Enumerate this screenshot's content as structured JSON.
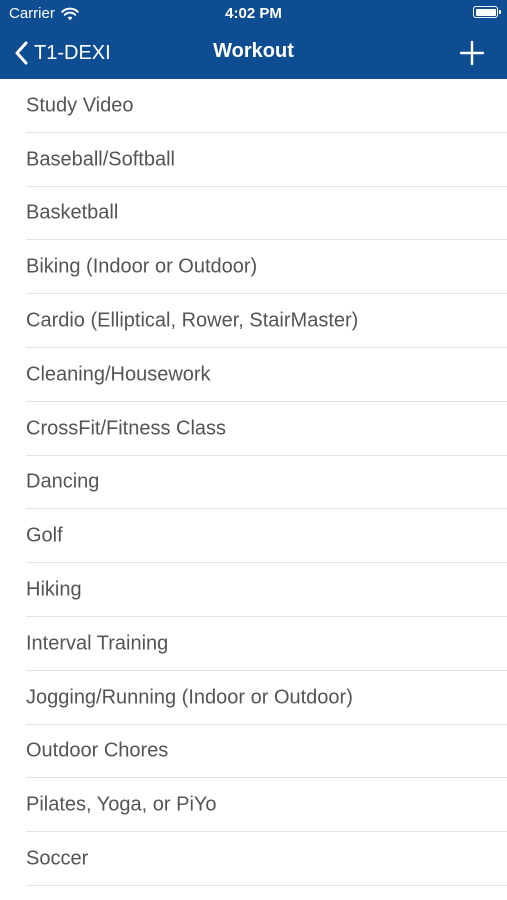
{
  "status_bar": {
    "carrier": "Carrier",
    "time": "4:02 PM"
  },
  "nav": {
    "back_label": "T1-DEXI",
    "title": "Workout"
  },
  "colors": {
    "header_bg": "#0f4d93",
    "row_text": "#545454",
    "divider": "#e3e3e3"
  },
  "icons": [
    "wifi-icon",
    "battery-icon",
    "chevron-left-icon",
    "plus-icon"
  ],
  "workouts": [
    "Study Video",
    "Baseball/Softball",
    "Basketball",
    "Biking (Indoor or Outdoor)",
    "Cardio (Elliptical, Rower, StairMaster)",
    "Cleaning/Housework",
    "CrossFit/Fitness Class",
    "Dancing",
    "Golf",
    "Hiking",
    "Interval Training",
    "Jogging/Running (Indoor or Outdoor)",
    "Outdoor Chores",
    "Pilates, Yoga, or PiYo",
    "Soccer"
  ]
}
